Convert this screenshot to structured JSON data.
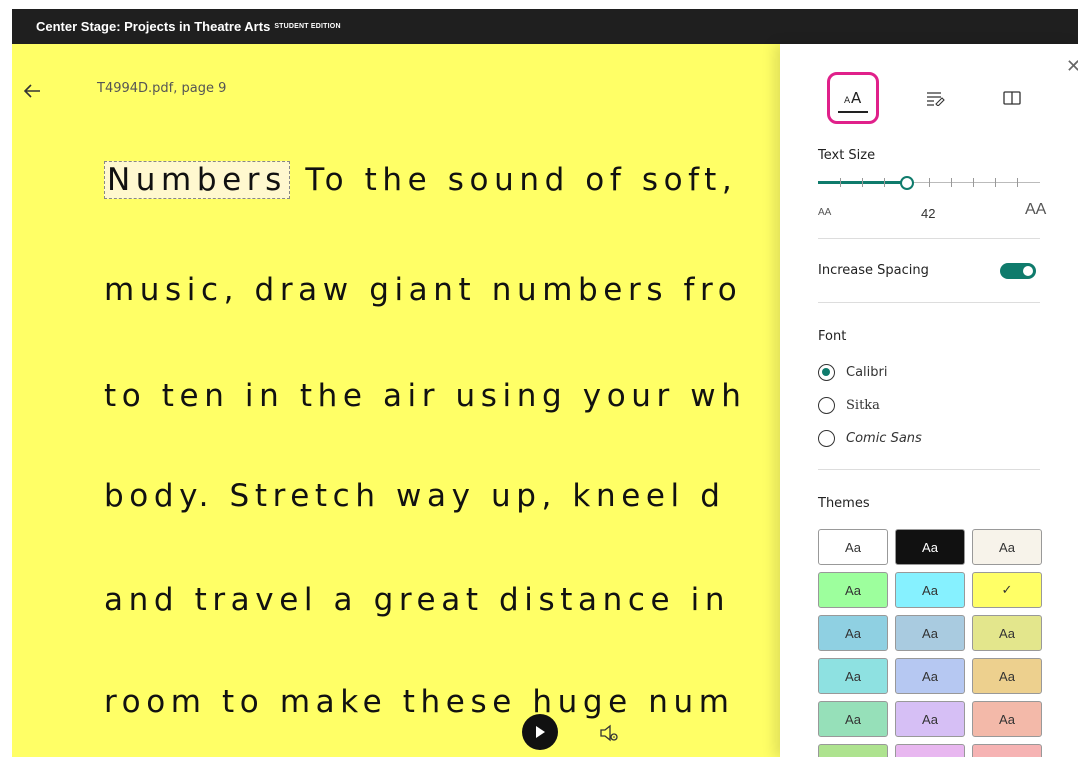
{
  "app": {
    "title": "Center Stage: Projects in Theatre Arts",
    "edition": "STUDENT EDITION"
  },
  "reader": {
    "filename": "T4994D.pdf, page 9",
    "highlighted_word": "Numbers",
    "lines": [
      " To the sound of soft,",
      "music, draw giant numbers fro",
      "to ten in the air using your wh",
      "body. Stretch way up, kneel d",
      "and travel a great distance in",
      "room to make these huge num"
    ],
    "background_color": "#ffff66"
  },
  "panel": {
    "tabs": [
      {
        "id": "text-preferences",
        "icon": "text-size-icon",
        "selected": true
      },
      {
        "id": "grammar-options",
        "icon": "grammar-icon",
        "selected": false
      },
      {
        "id": "reading-preferences",
        "icon": "book-icon",
        "selected": false
      }
    ],
    "text_size": {
      "label": "Text Size",
      "small_glyph": "AA",
      "large_glyph": "AA",
      "value": "42",
      "level_fraction": 0.4
    },
    "spacing": {
      "label": "Increase Spacing",
      "on": true
    },
    "font": {
      "label": "Font",
      "options": [
        {
          "label": "Calibri",
          "selected": true
        },
        {
          "label": "Sitka",
          "selected": false
        },
        {
          "label": "Comic Sans",
          "selected": false
        }
      ]
    },
    "themes": {
      "label": "Themes",
      "swatch_text": "Aa",
      "selected_mark": "✓",
      "swatches": [
        {
          "bg": "#ffffff",
          "fg": "#333333"
        },
        {
          "bg": "#111111",
          "fg": "#ffffff"
        },
        {
          "bg": "#f7f3ea",
          "fg": "#333333"
        },
        {
          "bg": "#9dff9d",
          "fg": "#333333"
        },
        {
          "bg": "#86f1ff",
          "fg": "#333333"
        },
        {
          "bg": "#ffff66",
          "fg": "#333333",
          "selected": true
        },
        {
          "bg": "#8fd0e2",
          "fg": "#333333"
        },
        {
          "bg": "#a9cbe0",
          "fg": "#333333"
        },
        {
          "bg": "#e3e68c",
          "fg": "#333333"
        },
        {
          "bg": "#8ee1e1",
          "fg": "#333333"
        },
        {
          "bg": "#b6c8f2",
          "fg": "#333333"
        },
        {
          "bg": "#edd08e",
          "fg": "#333333"
        },
        {
          "bg": "#96e0b9",
          "fg": "#333333"
        },
        {
          "bg": "#d6bff5",
          "fg": "#333333"
        },
        {
          "bg": "#f3b9a9",
          "fg": "#333333"
        },
        {
          "bg": "#aee38f",
          "fg": "#333333"
        },
        {
          "bg": "#e8b7f0",
          "fg": "#333333"
        },
        {
          "bg": "#f6b3b3",
          "fg": "#333333"
        }
      ]
    },
    "accent_color": "#0f7b6c",
    "selection_outline_color": "#e0208a"
  }
}
